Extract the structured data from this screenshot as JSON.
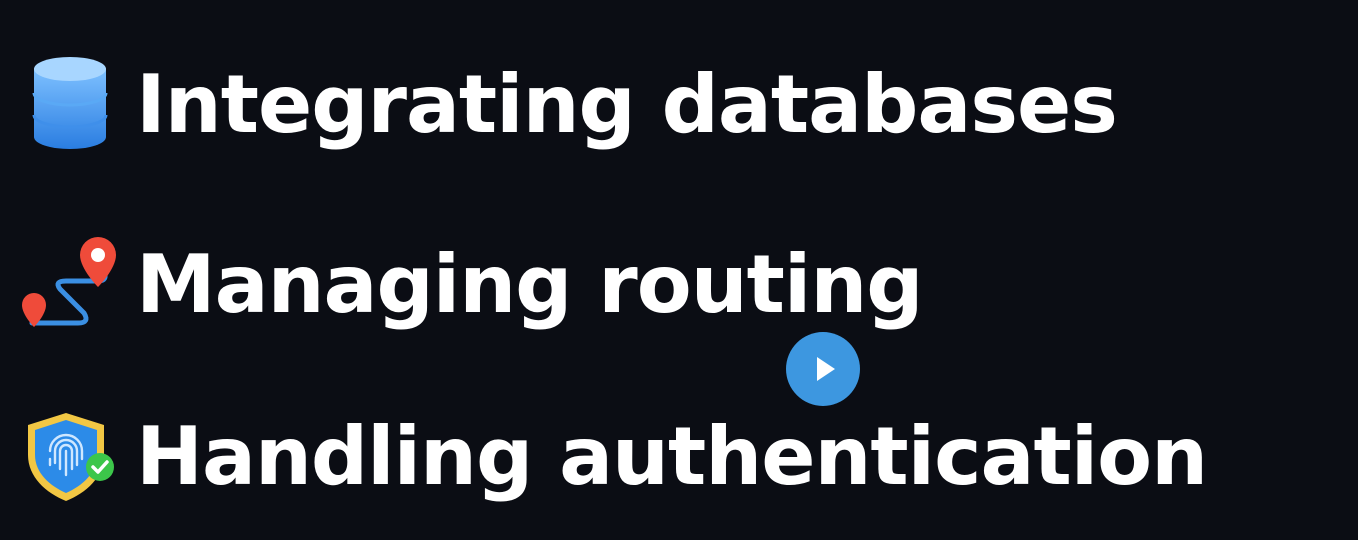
{
  "features": [
    {
      "label": "Integrating databases",
      "icon": "database-icon"
    },
    {
      "label": "Managing routing",
      "icon": "route-pin-icon"
    },
    {
      "label": "Handling authentication",
      "icon": "fingerprint-shield-icon"
    }
  ],
  "player": {
    "play_icon": "play-icon",
    "accent_color": "#3d97e0"
  },
  "colors": {
    "background": "#0b0d14",
    "text": "#ffffff"
  }
}
